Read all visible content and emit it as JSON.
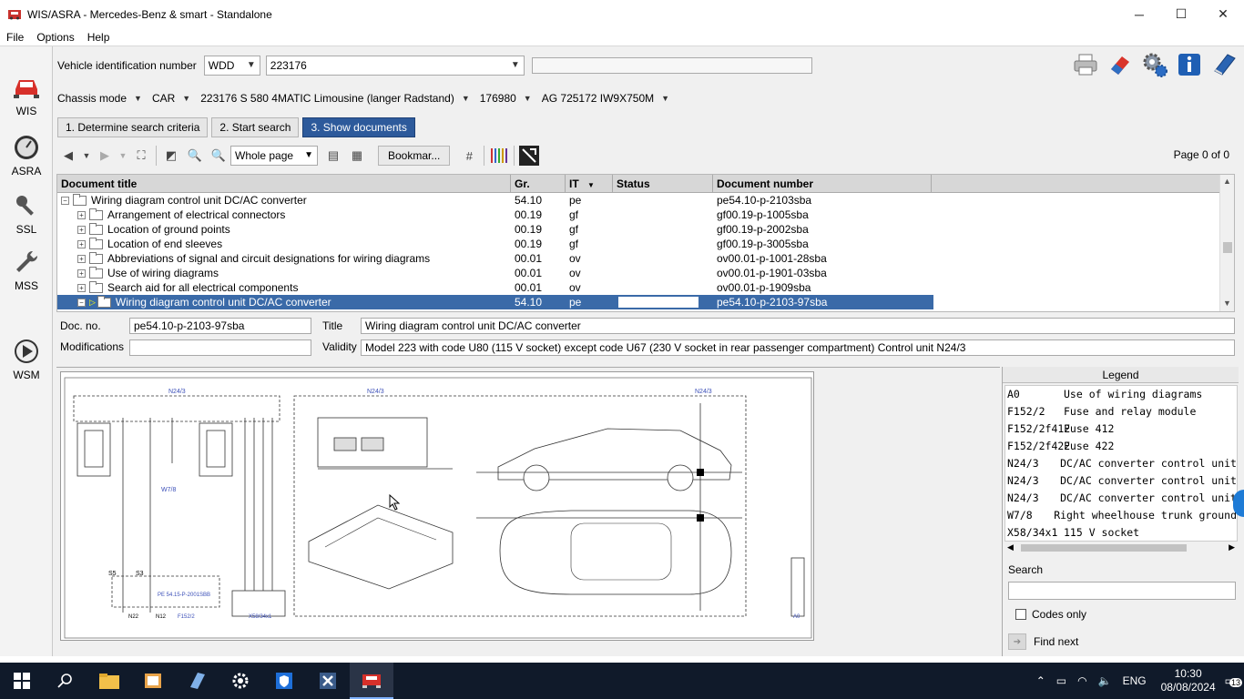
{
  "window": {
    "title": "WIS/ASRA - Mercedes-Benz & smart - Standalone",
    "min": "─",
    "max": "☐",
    "close": "✕"
  },
  "menu": [
    "File",
    "Options",
    "Help"
  ],
  "nav": {
    "wis": "WIS",
    "asra": "ASRA",
    "ssl": "SSL",
    "mss": "MSS",
    "wsm": "WSM"
  },
  "vin": {
    "label": "Vehicle identification number",
    "prefix": "WDD",
    "number": "223176"
  },
  "chassis": {
    "mode": "Chassis mode",
    "type": "CAR",
    "model": "223176 S 580 4MATIC Limousine (langer Radstand)",
    "engine": "176980",
    "transmission": "AG 725172 IW9X750M"
  },
  "steps": {
    "s1": "1. Determine search criteria",
    "s2": "2. Start search",
    "s3": "3. Show documents"
  },
  "tools": {
    "zoom": "Whole page",
    "bookmark": "Bookmar...",
    "page": "Page 0 of 0"
  },
  "table": {
    "headers": {
      "title": "Document title",
      "gr": "Gr.",
      "it": "IT",
      "status": "Status",
      "number": "Document number"
    },
    "rows": [
      {
        "title": "Wiring diagram control unit DC/AC converter",
        "gr": "54.10",
        "it": "pe",
        "number": "pe54.10-p-2103sba",
        "toggle": "−"
      },
      {
        "title": "Arrangement of electrical connectors",
        "gr": "00.19",
        "it": "gf",
        "number": "gf00.19-p-1005sba",
        "toggle": "+"
      },
      {
        "title": "Location of ground points",
        "gr": "00.19",
        "it": "gf",
        "number": "gf00.19-p-2002sba",
        "toggle": "+"
      },
      {
        "title": "Location of end sleeves",
        "gr": "00.19",
        "it": "gf",
        "number": "gf00.19-p-3005sba",
        "toggle": "+"
      },
      {
        "title": "Abbreviations of signal and circuit designations for wiring diagrams",
        "gr": "00.01",
        "it": "ov",
        "number": "ov00.01-p-1001-28sba",
        "toggle": "+"
      },
      {
        "title": "Use of wiring diagrams",
        "gr": "00.01",
        "it": "ov",
        "number": "ov00.01-p-1901-03sba",
        "toggle": "+"
      },
      {
        "title": "Search aid for all electrical components",
        "gr": "00.01",
        "it": "ov",
        "number": "ov00.01-p-1909sba",
        "toggle": "+"
      },
      {
        "title": "Wiring diagram control unit DC/AC converter",
        "gr": "54.10",
        "it": "pe",
        "number": "pe54.10-p-2103-97sba",
        "toggle": "−"
      }
    ]
  },
  "details": {
    "docno_label": "Doc. no.",
    "docno": "pe54.10-p-2103-97sba",
    "title_label": "Title",
    "title": "Wiring diagram control unit DC/AC converter",
    "mod_label": "Modifications",
    "modifications": "",
    "validity_label": "Validity",
    "validity": "Model 223 with code U80 (115 V socket) except code U67 (230 V socket in rear passenger compartment) Control unit N24/3"
  },
  "diagram": {
    "n243": "N24/3",
    "w78": "W7/8",
    "n22": "N22",
    "n12": "N12",
    "f152": "F152/2",
    "x58": "X58/34x1",
    "a0": "A0",
    "ref": "PE 54.15-P-2001SBB",
    "s5": "S5",
    "s3": "S3"
  },
  "legend": {
    "title": "Legend",
    "rows": [
      {
        "code": "A0",
        "desc": "Use of wiring diagrams"
      },
      {
        "code": "F152/2",
        "desc": "Fuse and relay module"
      },
      {
        "code": "F152/2f412",
        "desc": "Fuse 412"
      },
      {
        "code": "F152/2f422",
        "desc": "Fuse 422"
      },
      {
        "code": "N24/3",
        "desc": "DC/AC converter control unit"
      },
      {
        "code": "N24/3",
        "desc": "DC/AC converter control unit"
      },
      {
        "code": "N24/3",
        "desc": "DC/AC converter control unit"
      },
      {
        "code": "W7/8",
        "desc": "Right wheelhouse trunk ground"
      },
      {
        "code": "X58/34x1",
        "desc": "115 V socket"
      }
    ],
    "search_label": "Search",
    "codes_only": "Codes only",
    "find_next": "Find next"
  },
  "taskbar": {
    "lang": "ENG",
    "time": "10:30",
    "date": "08/08/2024",
    "notif": "13"
  }
}
